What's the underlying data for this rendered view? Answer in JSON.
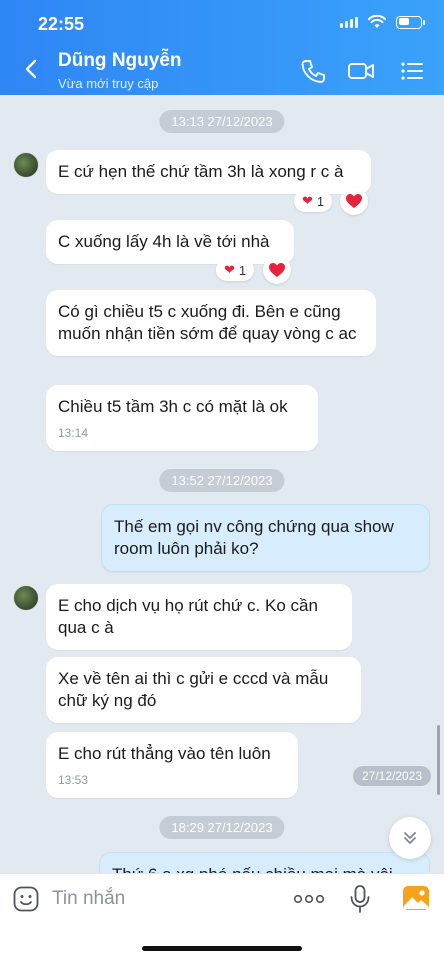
{
  "status": {
    "time": "22:55"
  },
  "header": {
    "name": "Dũng Nguyễn",
    "subtitle": "Vừa mới truy cập"
  },
  "colors": {
    "header_from": "#2f86f5",
    "header_to": "#3aa2fb",
    "my_bubble": "#d7ecfc",
    "heart": "#e5233a"
  },
  "icons": {
    "back": "chevron-left-icon",
    "call": "phone-icon",
    "video": "video-camera-icon",
    "menu": "list-icon"
  },
  "stamps": [
    "13:13 27/12/2023",
    "13:52 27/12/2023",
    "18:29 27/12/2023"
  ],
  "messages": [
    {
      "text": "E cứ hẹn thế chứ tầm 3h là xong r c à",
      "reaction_count": "1"
    },
    {
      "text": "C xuống lấy 4h là về tới nhà",
      "reaction_count": "1"
    },
    {
      "text": "Có gì chiều t5 c xuống đi. Bên e cũng muốn nhận tiền sớm để quay vòng c ac"
    },
    {
      "text": "Chiều t5 tầm 3h c có mặt là ok",
      "time": "13:14"
    },
    {
      "text": "Thế em gọi nv công chứng qua show room luôn phải ko?"
    },
    {
      "text": "E cho dịch vụ họ rút chứ c. Ko cần qua c à"
    },
    {
      "text": "Xe về tên ai thì c gửi e cccd và mẫu chữ ký ng đó"
    },
    {
      "text": "E cho rút thẳng vào tên luôn",
      "time": "13:53"
    },
    {
      "text": "Thứ 6 a xg phé nếu chiều mai mà vội"
    }
  ],
  "date_pill": "27/12/2023",
  "input": {
    "placeholder": "Tin nhắn"
  }
}
